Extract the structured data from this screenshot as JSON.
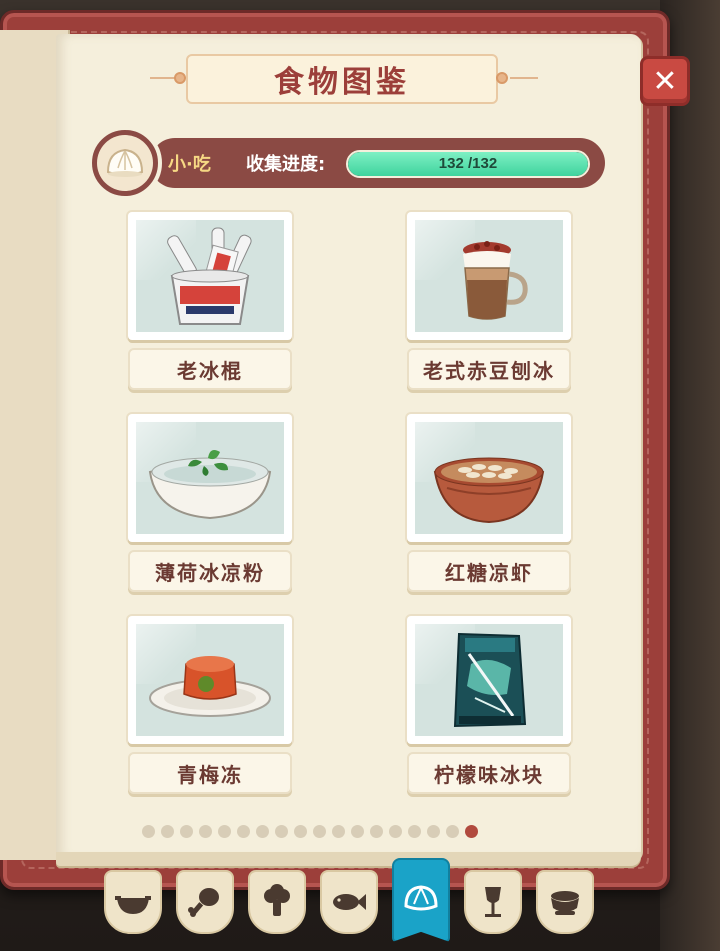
{
  "title": "食物图鉴",
  "close_label": "✕",
  "category": {
    "icon": "bun-icon",
    "label": "小·吃",
    "progress_label": "收集进度:",
    "progress_current": 132,
    "progress_total": 132,
    "progress_text": "132 /132"
  },
  "foods": [
    {
      "name": "老冰棍",
      "icon": "popsicle-bucket-icon"
    },
    {
      "name": "老式赤豆刨冰",
      "icon": "red-bean-shaved-ice-icon"
    },
    {
      "name": "薄荷冰凉粉",
      "icon": "mint-jelly-bowl-icon"
    },
    {
      "name": "红糖凉虾",
      "icon": "brown-sugar-jelly-bowl-icon"
    },
    {
      "name": "青梅冻",
      "icon": "plum-jelly-plate-icon"
    },
    {
      "name": "柠檬味冰块",
      "icon": "lemon-ice-bag-icon"
    }
  ],
  "pagination": {
    "total_pages": 18,
    "current_page": 18
  },
  "tabs": [
    {
      "icon": "wok-icon",
      "active": false
    },
    {
      "icon": "chicken-leg-icon",
      "active": false
    },
    {
      "icon": "broccoli-icon",
      "active": false
    },
    {
      "icon": "fish-icon",
      "active": false
    },
    {
      "icon": "bun-icon",
      "active": true
    },
    {
      "icon": "wine-glass-icon",
      "active": false
    },
    {
      "icon": "soup-bowl-icon",
      "active": false
    }
  ],
  "colors": {
    "accent": "#9c3f3a",
    "progress": "#3fd39d",
    "active_tab": "#1aa3c8"
  }
}
